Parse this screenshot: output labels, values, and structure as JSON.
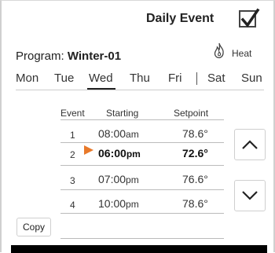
{
  "header": {
    "daily_event_label": "Daily Event",
    "daily_event_checked": true
  },
  "program": {
    "label": "Program:",
    "name": "Winter-01",
    "mode_icon": "flame-icon",
    "mode_label": "Heat"
  },
  "days": [
    "Mon",
    "Tue",
    "Wed",
    "Thu",
    "Fri",
    "Sat",
    "Sun"
  ],
  "selected_day": "Wed",
  "table": {
    "headers": {
      "event": "Event",
      "starting": "Starting",
      "setpoint": "Setpoint"
    },
    "rows": [
      {
        "event": "1",
        "time": "08:00",
        "ampm": "am",
        "setpoint": "78.6°",
        "selected": false
      },
      {
        "event": "2",
        "time": "06:00",
        "ampm": "pm",
        "setpoint": "72.6°",
        "selected": true
      },
      {
        "event": "3",
        "time": "07:00",
        "ampm": "pm",
        "setpoint": "76.6°",
        "selected": false
      },
      {
        "event": "4",
        "time": "10:00",
        "ampm": "pm",
        "setpoint": "78.6°",
        "selected": false
      }
    ]
  },
  "buttons": {
    "copy": "Copy",
    "up_icon": "chevron-up-icon",
    "down_icon": "chevron-down-icon"
  },
  "colors": {
    "accent": "#e8792a",
    "text": "#222222"
  }
}
